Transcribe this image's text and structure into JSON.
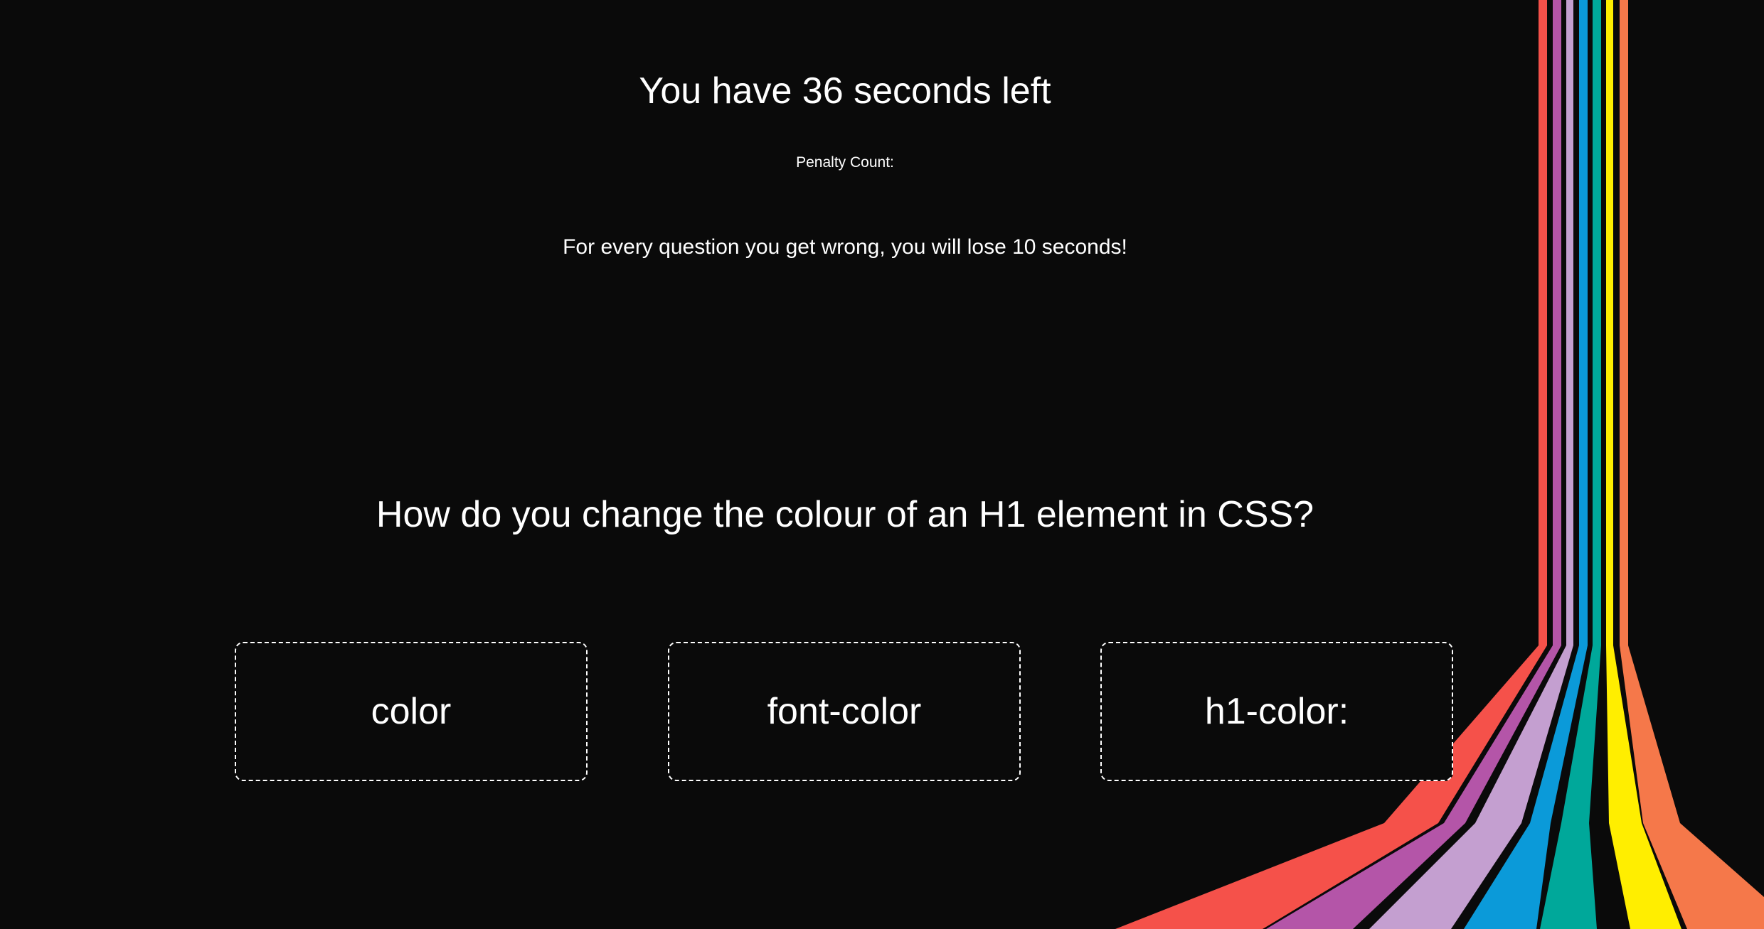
{
  "quiz": {
    "timer_text": "You have 36 seconds left",
    "penalty_label": "Penalty Count:",
    "warning_text": "For every question you get wrong, you will lose 10 seconds!",
    "question": "How do you change the colour of an H1 element in CSS?",
    "answers": [
      {
        "label": "color"
      },
      {
        "label": "font-color"
      },
      {
        "label": "h1-color:"
      }
    ]
  },
  "theme": {
    "background": "#0a0a0a",
    "text": "#ffffff",
    "stripes": [
      "#f5514a",
      "#b455a8",
      "#c49fd0",
      "#0b9ad9",
      "#00a89a",
      "#ffee00",
      "#f5784a"
    ]
  }
}
